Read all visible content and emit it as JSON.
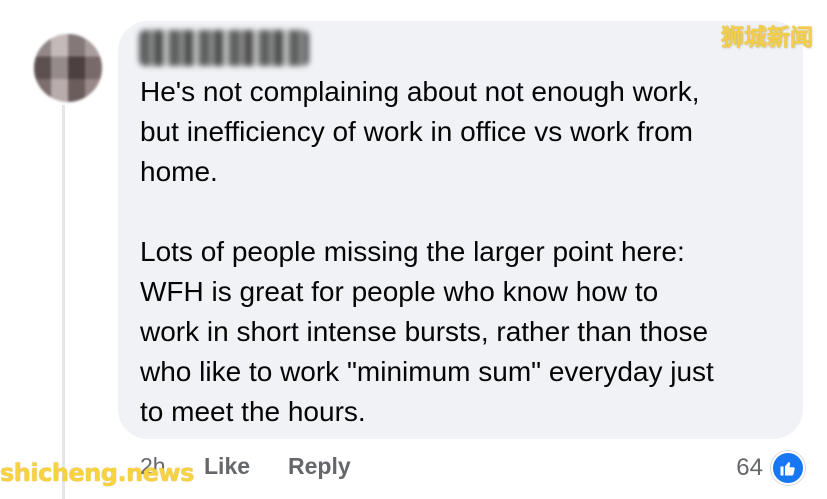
{
  "watermarks": {
    "top": "狮城新闻",
    "bottom": "shicheng.news"
  },
  "comment": {
    "author_name": "",
    "text": "He's not complaining about not enough work,\nbut inefficiency of work in office vs work from\nhome.\n\nLots of people missing the larger point here:\nWFH is great for people who know how to\nwork in short intense bursts, rather than those\nwho like to work \"minimum sum\" everyday just\nto meet the hours."
  },
  "actions": {
    "time": "2h",
    "like": "Like",
    "reply": "Reply"
  },
  "reactions": {
    "count": "64",
    "icon": "thumbs-up-icon",
    "icon_bg_color": "#1877F2"
  },
  "colors": {
    "bubble_bg": "#F0F2F5",
    "secondary_text": "#65676B",
    "watermark": "#F2CE4A"
  }
}
